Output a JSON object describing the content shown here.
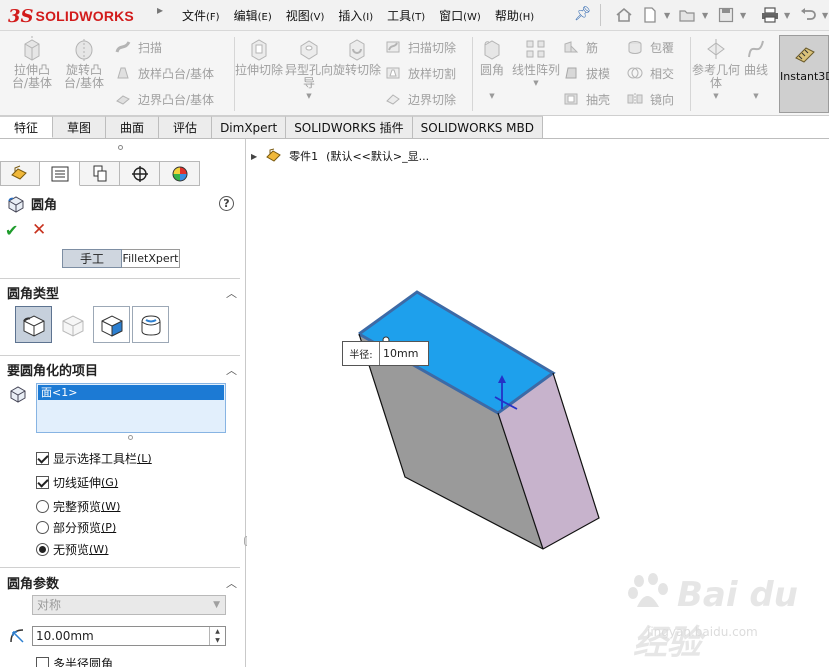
{
  "app": {
    "logo_ds": "3S",
    "logo_name": "SOLIDWORKS"
  },
  "menubar": {
    "items": [
      {
        "label": "文件",
        "accel": "(F)"
      },
      {
        "label": "编辑",
        "accel": "(E)"
      },
      {
        "label": "视图",
        "accel": "(V)"
      },
      {
        "label": "插入",
        "accel": "(I)"
      },
      {
        "label": "工具",
        "accel": "(T)"
      },
      {
        "label": "窗口",
        "accel": "(W)"
      },
      {
        "label": "帮助",
        "accel": "(H)"
      }
    ]
  },
  "quick_access": {
    "icons": [
      "home-icon",
      "new-document-icon",
      "open-folder-icon",
      "save-icon",
      "print-icon",
      "undo-icon"
    ]
  },
  "commands": {
    "extrude_boss": "拉伸凸台/基体",
    "revolve_boss": "旋转凸台/基体",
    "sweep": "扫描",
    "loft_boss": "放样凸台/基体",
    "boundary_boss": "边界凸台/基体",
    "extrude_cut": "拉伸切除",
    "hole_wizard": "异型孔向导",
    "revolve_cut": "旋转切除",
    "swept_cut": "扫描切除",
    "lofted_cut": "放样切割",
    "boundary_cut": "边界切除",
    "fillet": "圆角",
    "linear_pattern": "线性阵列",
    "rib": "筋",
    "draft": "拔模",
    "shell": "抽壳",
    "wrap": "包覆",
    "intersect": "相交",
    "mirror": "镜向",
    "reference_geometry": "参考几何体",
    "curves": "曲线",
    "instant3d": "Instant3D"
  },
  "tabs": [
    {
      "label": "特征",
      "active": true
    },
    {
      "label": "草图",
      "active": false
    },
    {
      "label": "曲面",
      "active": false
    },
    {
      "label": "评估",
      "active": false
    },
    {
      "label": "DimXpert",
      "active": false
    },
    {
      "label": "SOLIDWORKS 插件",
      "active": false
    },
    {
      "label": "SOLIDWORKS MBD",
      "active": false
    }
  ],
  "property_manager": {
    "title": "圆角",
    "mode_manual": "手工",
    "mode_filletxpert": "FilletXpert",
    "section_type": "圆角类型",
    "section_items": "要圆角化的项目",
    "selected_item": "面<1>",
    "opt_show_toolbar": "显示选择工具栏",
    "opt_show_toolbar_acc": "(L)",
    "opt_tangent": "切线延伸",
    "opt_tangent_acc": "(G)",
    "radio_full": "完整预览",
    "radio_full_acc": "(W)",
    "radio_partial": "部分预览",
    "radio_partial_acc": "(P)",
    "radio_none": "无预览",
    "radio_none_acc": "(W)",
    "section_params": "圆角参数",
    "symmetric": "对称",
    "radius_value": "10.00mm",
    "multi_radius": "多半径圆角",
    "show_toolbar_checked": true,
    "tangent_checked": true,
    "preview_mode": "none",
    "multi_radius_checked": false
  },
  "viewport": {
    "tree_part": "零件1",
    "tree_config": "(默认<<默认>_显...",
    "callout_label": "半径:",
    "callout_value": "10mm",
    "watermark": "Bai du 经验",
    "watermark_sub": "jingyan.baidu.com",
    "colors": {
      "top_face": "#1ea0ec",
      "top_edge": "#3d6aa6",
      "side_face_left": "#9a9a9a",
      "side_face_right": "#c7b3cc"
    }
  }
}
